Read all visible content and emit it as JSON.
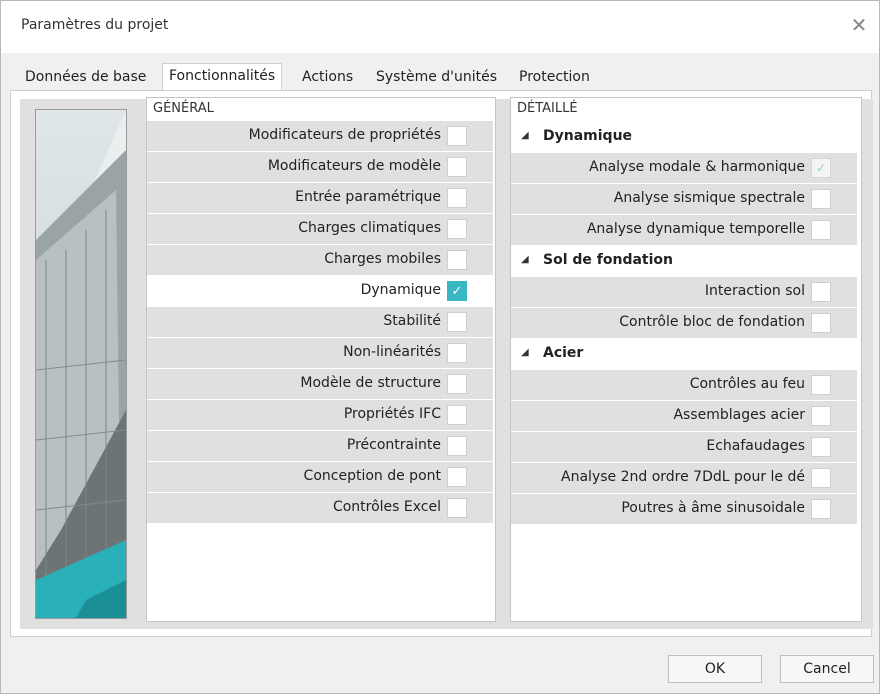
{
  "window": {
    "title": "Paramètres du projet",
    "close_glyph": "✕"
  },
  "tabs": [
    {
      "label": "Données de base"
    },
    {
      "label": "Fonctionnalités",
      "active": true
    },
    {
      "label": "Actions"
    },
    {
      "label": "Système d'unités"
    },
    {
      "label": "Protection"
    }
  ],
  "general": {
    "header": "GÉNÉRAL",
    "items": [
      {
        "label": "Modificateurs de propriétés",
        "checked": false
      },
      {
        "label": "Modificateurs de modèle",
        "checked": false
      },
      {
        "label": "Entrée paramétrique",
        "checked": false
      },
      {
        "label": "Charges climatiques",
        "checked": false
      },
      {
        "label": "Charges mobiles",
        "checked": false
      },
      {
        "label": "Dynamique",
        "checked": true
      },
      {
        "label": "Stabilité",
        "checked": false
      },
      {
        "label": "Non-linéarités",
        "checked": false
      },
      {
        "label": "Modèle de structure",
        "checked": false
      },
      {
        "label": "Propriétés IFC",
        "checked": false
      },
      {
        "label": "Précontrainte",
        "checked": false
      },
      {
        "label": "Conception de pont",
        "checked": false
      },
      {
        "label": "Contrôles Excel",
        "checked": false
      }
    ]
  },
  "detail": {
    "header": "DÉTAILLÉ",
    "groups": [
      {
        "title": "Dynamique",
        "items": [
          {
            "label": "Analyse modale & harmonique",
            "checked": true,
            "disabled": true
          },
          {
            "label": "Analyse sismique spectrale",
            "checked": false
          },
          {
            "label": "Analyse dynamique temporelle",
            "checked": false
          }
        ]
      },
      {
        "title": "Sol de fondation",
        "items": [
          {
            "label": "Interaction sol",
            "checked": false
          },
          {
            "label": "Contrôle bloc de fondation",
            "checked": false
          }
        ]
      },
      {
        "title": "Acier",
        "items": [
          {
            "label": "Contrôles au feu",
            "checked": false
          },
          {
            "label": "Assemblages acier",
            "checked": false
          },
          {
            "label": "Echafaudages",
            "checked": false
          },
          {
            "label": "Analyse 2nd ordre 7DdL pour le dé",
            "checked": false
          },
          {
            "label": "Poutres à âme sinusoidale",
            "checked": false
          }
        ]
      }
    ]
  },
  "buttons": {
    "ok": "OK",
    "cancel": "Cancel"
  },
  "colors": {
    "accent": "#37b8c2"
  }
}
